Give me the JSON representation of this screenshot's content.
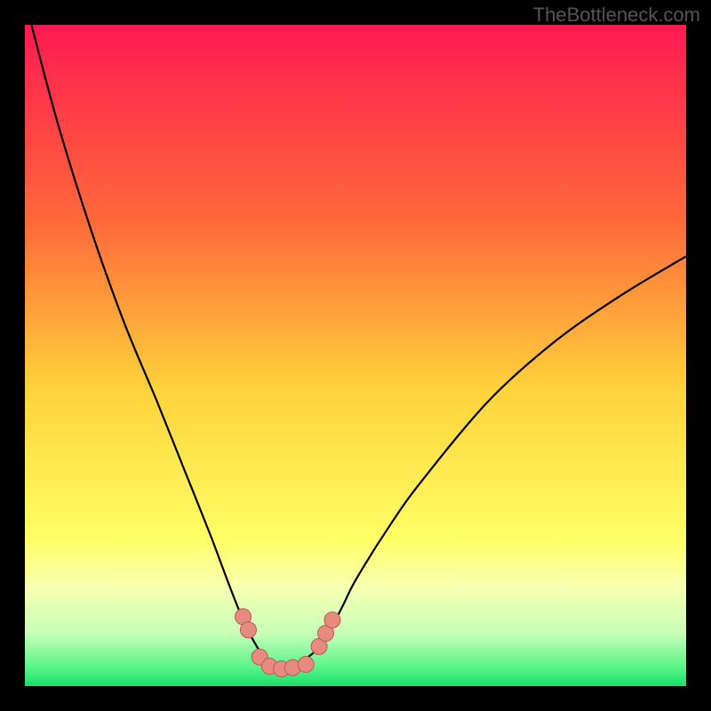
{
  "watermark": "TheBottleneck.com",
  "chart_data": {
    "type": "line",
    "title": "",
    "xlabel": "",
    "ylabel": "",
    "xlim": [
      0,
      100
    ],
    "ylim": [
      0,
      100
    ],
    "background_gradient": {
      "stops": [
        {
          "offset": 0,
          "color": "#ff1a52"
        },
        {
          "offset": 30,
          "color": "#ff6a3a"
        },
        {
          "offset": 55,
          "color": "#ffd23a"
        },
        {
          "offset": 78,
          "color": "#ffff66"
        },
        {
          "offset": 85,
          "color": "#f7ffb0"
        },
        {
          "offset": 92,
          "color": "#c8ffb8"
        },
        {
          "offset": 97,
          "color": "#5cf58a"
        },
        {
          "offset": 100,
          "color": "#18e06a"
        }
      ]
    },
    "series": [
      {
        "name": "bottleneck-curve",
        "color": "#000000",
        "x": [
          1,
          5,
          10,
          15,
          20,
          24,
          28,
          31,
          33,
          34.5,
          36,
          37,
          38,
          40,
          42,
          45,
          48,
          50,
          55,
          60,
          70,
          80,
          90,
          100
        ],
        "y": [
          100,
          85,
          69,
          55,
          43,
          33,
          23,
          15,
          10,
          7,
          4.5,
          3,
          2.5,
          2.8,
          3.8,
          6.5,
          12,
          16,
          24,
          31,
          43,
          52,
          59,
          65
        ]
      }
    ],
    "markers": {
      "name": "data-points",
      "color": "#e88a82",
      "stroke": "#b85a52",
      "r": 9,
      "points": [
        {
          "x": 33.0,
          "y": 10.5
        },
        {
          "x": 33.8,
          "y": 8.5
        },
        {
          "x": 35.5,
          "y": 4.4
        },
        {
          "x": 37.0,
          "y": 3.0
        },
        {
          "x": 38.8,
          "y": 2.6
        },
        {
          "x": 40.5,
          "y": 2.8
        },
        {
          "x": 42.5,
          "y": 3.3
        },
        {
          "x": 44.5,
          "y": 6.0
        },
        {
          "x": 45.5,
          "y": 8.0
        },
        {
          "x": 46.5,
          "y": 10.0
        }
      ]
    }
  }
}
